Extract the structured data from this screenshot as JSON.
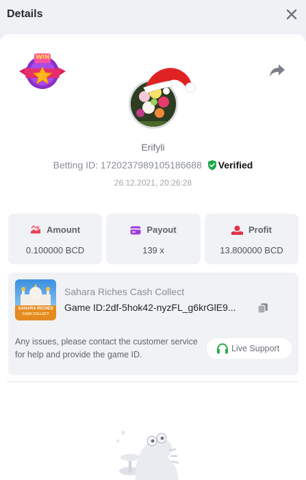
{
  "header": {
    "title": "Details"
  },
  "player": {
    "username": "Erifyli",
    "betting_id_label": "Betting ID:",
    "betting_id": "1720237989105186688",
    "verified_label": "Verified",
    "datetime": "26.12.2021, 20:26:28"
  },
  "badge": {
    "text": "WIN"
  },
  "stats": {
    "amount": {
      "label": "Amount",
      "value": "0.100000 BCD"
    },
    "payout": {
      "label": "Payout",
      "value": "139 x"
    },
    "profit": {
      "label": "Profit",
      "value": "13.800000 BCD"
    }
  },
  "game": {
    "thumb_title": "SAHARA RICHES",
    "thumb_subtitle": "CASH COLLECT",
    "name": "Sahara Riches Cash Collect",
    "id_label": "Game ID:",
    "id_value": "2df-5hok42-nyzFL_g6krGlE9..."
  },
  "support": {
    "help_text": "Any issues, please contact the customer service for help and provide the game ID.",
    "button_label": "Live Support"
  },
  "colors": {
    "verified_green": "#1aa84b",
    "amount_icon": "#e8455a",
    "payout_icon": "#9d3fd8",
    "profit_icon": "#e2334a",
    "support_green": "#2aa84a"
  },
  "icons": {
    "close": "close-icon",
    "share": "share-icon",
    "copy": "copy-icon",
    "headset": "headset-icon"
  }
}
